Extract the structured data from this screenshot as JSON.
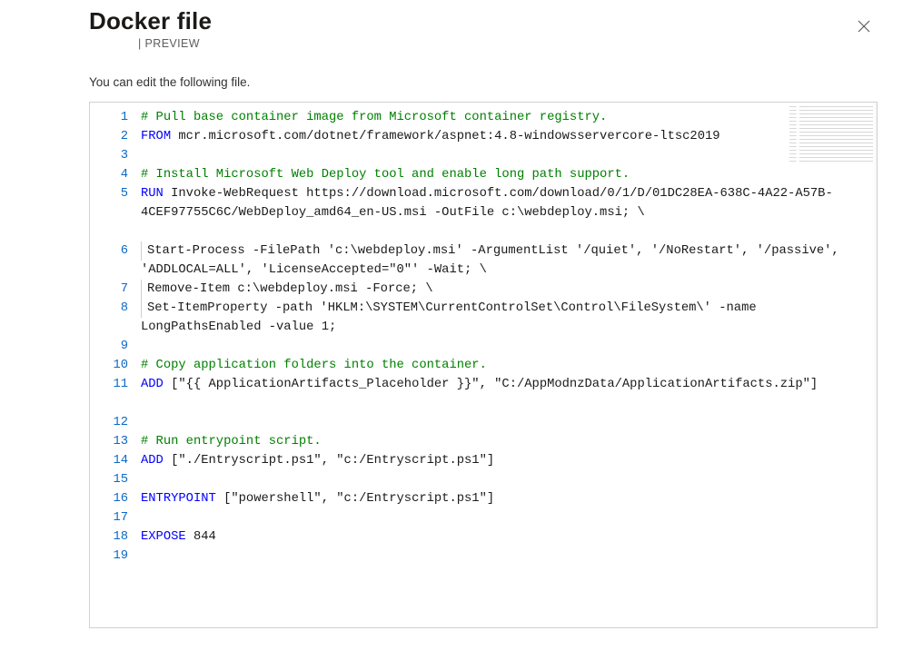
{
  "header": {
    "title": "Docker file",
    "subtitle_separator": "|",
    "subtitle_tag": "PREVIEW"
  },
  "instruction": "You can edit the following file.",
  "close_label": "Close",
  "editor": {
    "lines": [
      {
        "n": 1,
        "wrap": 1,
        "content": "# Pull base container image from Microsoft container registry."
      },
      {
        "n": 2,
        "wrap": 1,
        "content": "FROM mcr.microsoft.com/dotnet/framework/aspnet:4.8-windowsservercore-ltsc2019"
      },
      {
        "n": 3,
        "wrap": 1,
        "content": ""
      },
      {
        "n": 4,
        "wrap": 1,
        "content": "# Install Microsoft Web Deploy tool and enable long path support."
      },
      {
        "n": 5,
        "wrap": 3,
        "content": "RUN Invoke-WebRequest https://download.microsoft.com/download/0/1/D/01DC28EA-638C-4A22-A57B-4CEF97755C6C/WebDeploy_amd64_en-US.msi -OutFile c:\\webdeploy.msi; \\"
      },
      {
        "n": 6,
        "wrap": 2,
        "indent": true,
        "content": "Start-Process -FilePath 'c:\\webdeploy.msi' -ArgumentList '/quiet', '/NoRestart', '/passive', 'ADDLOCAL=ALL', 'LicenseAccepted=\"0\"' -Wait; \\"
      },
      {
        "n": 7,
        "wrap": 1,
        "indent": true,
        "content": "Remove-Item c:\\webdeploy.msi -Force; \\"
      },
      {
        "n": 8,
        "wrap": 2,
        "indent": true,
        "content": "Set-ItemProperty -path 'HKLM:\\SYSTEM\\CurrentControlSet\\Control\\FileSystem\\' -name LongPathsEnabled -value 1;"
      },
      {
        "n": 9,
        "wrap": 1,
        "content": ""
      },
      {
        "n": 10,
        "wrap": 1,
        "content": "# Copy application folders into the container."
      },
      {
        "n": 11,
        "wrap": 2,
        "content": "ADD [\"{{ ApplicationArtifacts_Placeholder }}\", \"C:/AppModnzData/ApplicationArtifacts.zip\"]"
      },
      {
        "n": 12,
        "wrap": 1,
        "content": ""
      },
      {
        "n": 13,
        "wrap": 1,
        "content": "# Run entrypoint script."
      },
      {
        "n": 14,
        "wrap": 1,
        "content": "ADD [\"./Entryscript.ps1\", \"c:/Entryscript.ps1\"]"
      },
      {
        "n": 15,
        "wrap": 1,
        "content": ""
      },
      {
        "n": 16,
        "wrap": 1,
        "content": "ENTRYPOINT [\"powershell\", \"c:/Entryscript.ps1\"]"
      },
      {
        "n": 17,
        "wrap": 1,
        "content": ""
      },
      {
        "n": 18,
        "wrap": 1,
        "content": "EXPOSE 844"
      },
      {
        "n": 19,
        "wrap": 1,
        "content": ""
      }
    ]
  }
}
